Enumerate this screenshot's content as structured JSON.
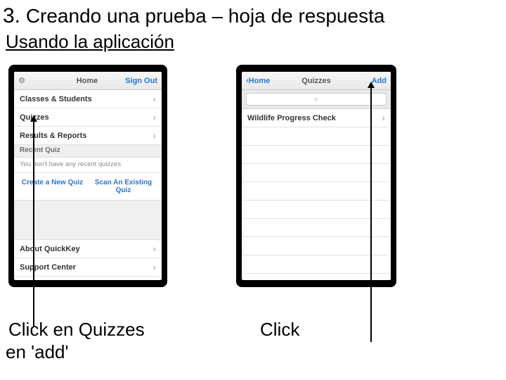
{
  "title_number": "3.",
  "title_text": "Creando una prueba – hoja de respuesta",
  "subtitle": "Usando la aplicación",
  "phone_left": {
    "nav": {
      "left_icon": "⚙",
      "center": "Home",
      "right": "Sign Out"
    },
    "rows": {
      "classes": "Classes & Students",
      "quizzes": "Quizzes",
      "results": "Results & Reports"
    },
    "recent_header": "Recent Quiz",
    "recent_sub": "You don't have any recent quizzes",
    "links": {
      "create": "Create a New Quiz",
      "scan": "Scan An Existing Quiz"
    },
    "about": "About QuickKey",
    "support": "Support Center"
  },
  "phone_right": {
    "nav": {
      "left": "Home",
      "center": "Quizzes",
      "right": "Add"
    },
    "search_icon": "⌕",
    "quiz_name": "Wildlife Progress Check"
  },
  "captions": {
    "left": "Click en Quizzes",
    "right_click": "Click",
    "right_add": "en  'add'"
  },
  "glyphs": {
    "chevron": "›",
    "back": "‹"
  }
}
